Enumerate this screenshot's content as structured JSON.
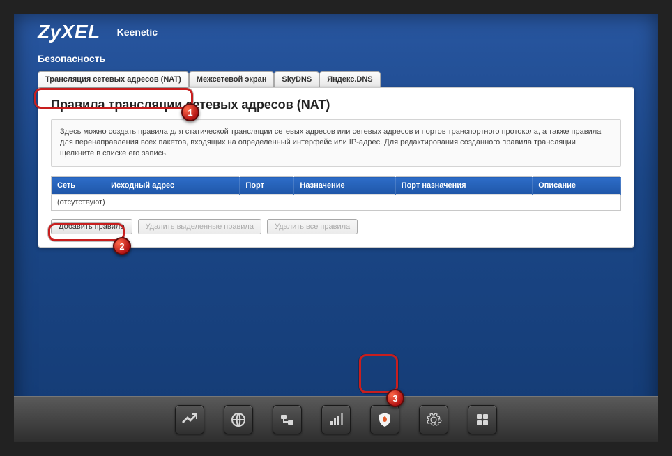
{
  "brand": {
    "logo": "ZyXEL",
    "model": "Keenetic"
  },
  "section": "Безопасность",
  "tabs": [
    {
      "label": "Трансляция сетевых адресов (NAT)",
      "active": true
    },
    {
      "label": "Межсетевой экран",
      "active": false
    },
    {
      "label": "SkyDNS",
      "active": false
    },
    {
      "label": "Яндекс.DNS",
      "active": false
    }
  ],
  "panel": {
    "title": "Правила трансляции сетевых адресов (NAT)",
    "info": "Здесь можно создать правила для статической трансляции сетевых адресов или сетевых адресов и портов транспортного протокола, а также правила для перенаправления всех пакетов, входящих на определенный интерфейс или IP-адрес. Для редактирования созданного правила трансляции щелкните в списке его запись.",
    "columns": [
      "Сеть",
      "Исходный адрес",
      "Порт",
      "Назначение",
      "Порт назначения",
      "Описание"
    ],
    "empty_text": "(отсутствуют)"
  },
  "buttons": {
    "add": "Добавить правило",
    "delete_selected": "Удалить выделенные правила",
    "delete_all": "Удалить все правила"
  },
  "nav_icons": [
    "stats-icon",
    "globe-icon",
    "network-icon",
    "wifi-icon",
    "firewall-icon",
    "gear-icon",
    "apps-icon"
  ],
  "callouts": {
    "1": "1",
    "2": "2",
    "3": "3"
  }
}
